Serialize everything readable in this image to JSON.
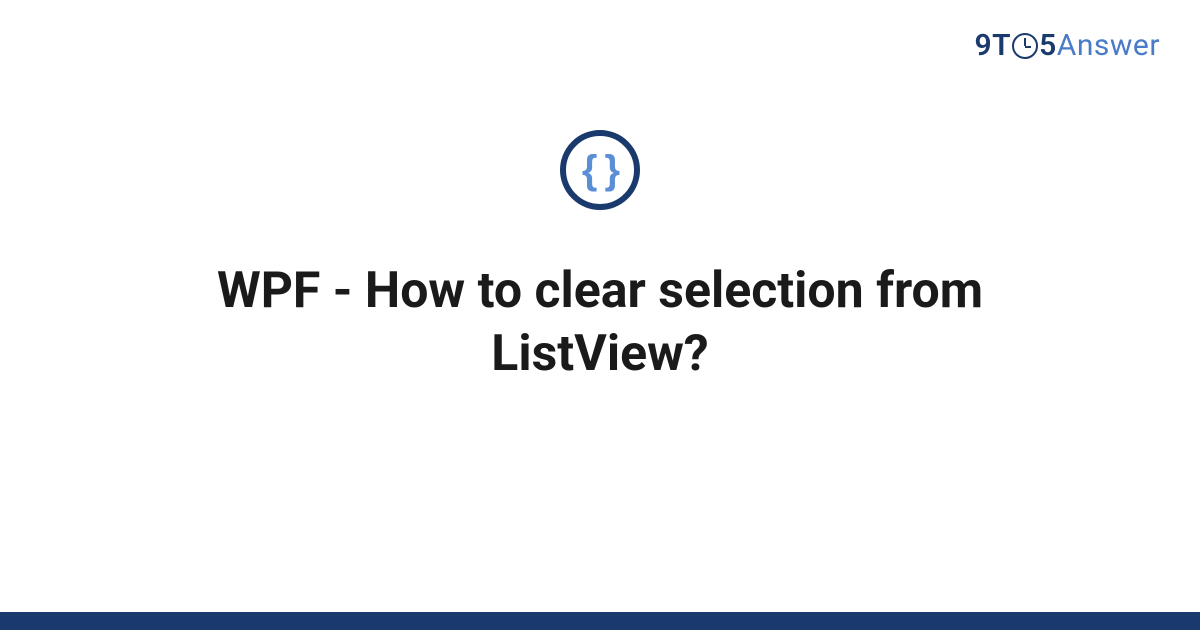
{
  "brand": {
    "part1": "9T",
    "part2": "5",
    "part3": "Answer"
  },
  "category": {
    "icon_name": "code-braces-icon",
    "icon_glyph": "{ }"
  },
  "question": {
    "title": "WPF - How to clear selection from ListView?"
  },
  "colors": {
    "primary_dark": "#1a3a6e",
    "primary_light": "#4a7bc8",
    "brace_blue": "#5a8fd6",
    "text": "#1a1a1a"
  }
}
